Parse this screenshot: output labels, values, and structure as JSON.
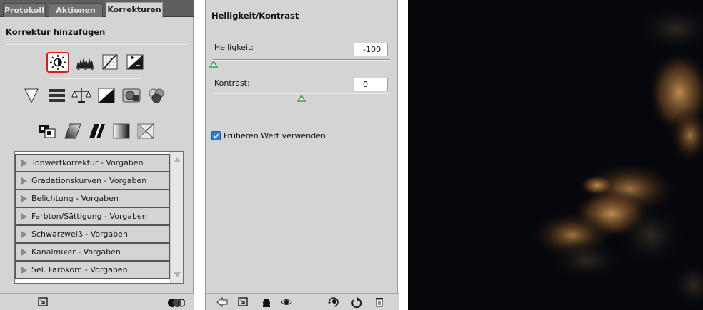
{
  "left_panel": {
    "tabs": [
      {
        "label": "Protokoll",
        "active": false
      },
      {
        "label": "Aktionen",
        "active": false
      },
      {
        "label": "Korrekturen",
        "active": true
      }
    ],
    "title": "Korrektur hinzufügen",
    "icon_rows": [
      [
        "brightness-contrast-icon",
        "levels-icon",
        "curves-icon",
        "exposure-icon"
      ],
      [
        "vibrance-icon",
        "hue-saturation-icon",
        "color-balance-icon",
        "black-white-icon",
        "photo-filter-icon",
        "channel-mixer-icon"
      ],
      [
        "invert-icon",
        "posterize-icon",
        "threshold-icon",
        "gradient-map-icon",
        "selective-color-icon"
      ]
    ],
    "selected_icon": "brightness-contrast-icon",
    "presets": [
      "Tonwertkorrektur - Vorgaben",
      "Gradationskurven - Vorgaben",
      "Belichtung - Vorgaben",
      "Farbton/Sättigung - Vorgaben",
      "Schwarzweiß - Vorgaben",
      "Kanalmixer - Vorgaben",
      "Sel. Farbkorr. - Vorgaben"
    ],
    "footer_icons": [
      "panel-toggle-icon",
      "clip-layers-icon"
    ]
  },
  "mid_panel": {
    "title": "Helligkeit/Kontrast",
    "brightness": {
      "label": "Helligkeit:",
      "value": "-100",
      "slider_fraction": 0.0
    },
    "contrast": {
      "label": "Kontrast:",
      "value": "0",
      "slider_fraction": 0.5
    },
    "checkbox": {
      "label": "Früheren Wert verwenden",
      "checked": true
    },
    "footer_icons": [
      "back-arrow-icon",
      "panel-toggle-icon",
      "clip-layer-icon",
      "eye-icon",
      "view-previous-icon",
      "reset-icon",
      "trash-icon"
    ]
  },
  "image": {
    "description_colors": {
      "sky": "#05070c",
      "cloud_highlight": "#c9904e"
    }
  },
  "colors": {
    "panel_bg": "#d4d4d4",
    "accent_check": "#2b7fd4",
    "selection_red": "#e4171d"
  }
}
